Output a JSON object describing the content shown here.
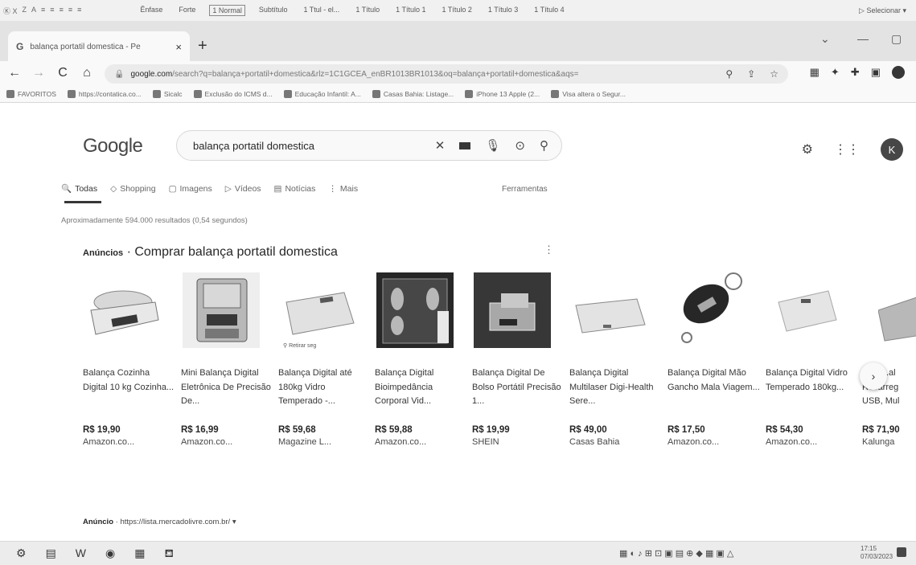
{
  "ribbon": {
    "left": [
      "Ⓚ X",
      "Z",
      "A",
      "≡",
      "≡",
      "≡",
      "≡",
      "≡"
    ],
    "styles": [
      {
        "label": "Ênfase",
        "selected": false
      },
      {
        "label": "Forte",
        "selected": false
      },
      {
        "label": "1 Normal",
        "selected": true
      },
      {
        "label": "Subtítulo",
        "selected": false
      },
      {
        "label": "1 Ttul - el...",
        "selected": false
      },
      {
        "label": "1 Título",
        "selected": false
      },
      {
        "label": "1 Título 1",
        "selected": false
      },
      {
        "label": "1 Título 2",
        "selected": false
      },
      {
        "label": "1 Título 3",
        "selected": false
      },
      {
        "label": "1 Título 4",
        "selected": false
      }
    ],
    "select_label": "Selecionar"
  },
  "browser": {
    "tab_title": "balança portatil domestica - Pe",
    "tab_close": "×",
    "new_tab": "+",
    "url_host": "google.com",
    "url_path": "/search?q=balança+portatil+domestica&rlz=1C1GCEA_enBR1013BR1013&oq=balança+portatil+domestica&aqs=",
    "bookmarks": [
      "FAVORITOS",
      "https://contatica.co...",
      "Sicalc",
      "Exclusão do ICMS d...",
      "Educação Infantil: A...",
      "Casas Bahia: Listage...",
      "iPhone 13 Apple (2...",
      "Visa altera o Segur..."
    ]
  },
  "google": {
    "logo": "Google",
    "query": "balança portatil domestica",
    "avatar_letter": "K",
    "tabs": [
      {
        "label": "Todas",
        "icon": "🔍",
        "active": true
      },
      {
        "label": "Shopping",
        "icon": "◇",
        "active": false
      },
      {
        "label": "Imagens",
        "icon": "▢",
        "active": false
      },
      {
        "label": "Vídeos",
        "icon": "▷",
        "active": false
      },
      {
        "label": "Notícias",
        "icon": "▤",
        "active": false
      },
      {
        "label": "Mais",
        "icon": "⋮",
        "active": false
      }
    ],
    "tools_label": "Ferramentas",
    "result_count": "Aproximadamente 594.000 resultados (0,54 segundos)",
    "ads_prefix": "Anúncios",
    "ads_title": " · Comprar balança portatil domestica",
    "ads_menu": "⋮"
  },
  "products": [
    {
      "name": "Balança Cozinha Digital 10 kg Cozinha...",
      "price": "R$ 19,90",
      "store": "Amazon.co..."
    },
    {
      "name": "Mini Balança Digital Eletrônica De Precisão De...",
      "price": "R$ 16,99",
      "store": "Amazon.co..."
    },
    {
      "name": "Balança Digital até 180kg Vidro Temperado -...",
      "price": "R$ 59,68",
      "store": "Magazine L...",
      "badge": "Retirar seg"
    },
    {
      "name": "Balança Digital Bioimpedância Corporal Vid...",
      "price": "R$ 59,88",
      "store": "Amazon.co..."
    },
    {
      "name": "Balança Digital De Bolso Portátil Precisão 1...",
      "price": "R$ 19,99",
      "store": "SHEIN"
    },
    {
      "name": "Balança Digital Multilaser Digi-Health Sere...",
      "price": "R$ 49,00",
      "store": "Casas Bahia"
    },
    {
      "name": "Balança Digital Mão Gancho Mala Viagem...",
      "price": "R$ 17,50",
      "store": "Amazon.co..."
    },
    {
      "name": "Balança Digital Vidro Temperado 180kg...",
      "price": "R$ 54,30",
      "store": "Amazon.co..."
    },
    {
      "name": "...ça ...al Recarreg USB, Mul",
      "price": "R$ 71,90",
      "store": "Kalunga"
    }
  ],
  "anuncio": {
    "label": "Anúncio",
    "url": " · https://lista.mercadolivre.com.br/ ▾"
  },
  "taskbar": {
    "time": "17:15",
    "date": "07/03/2023"
  }
}
